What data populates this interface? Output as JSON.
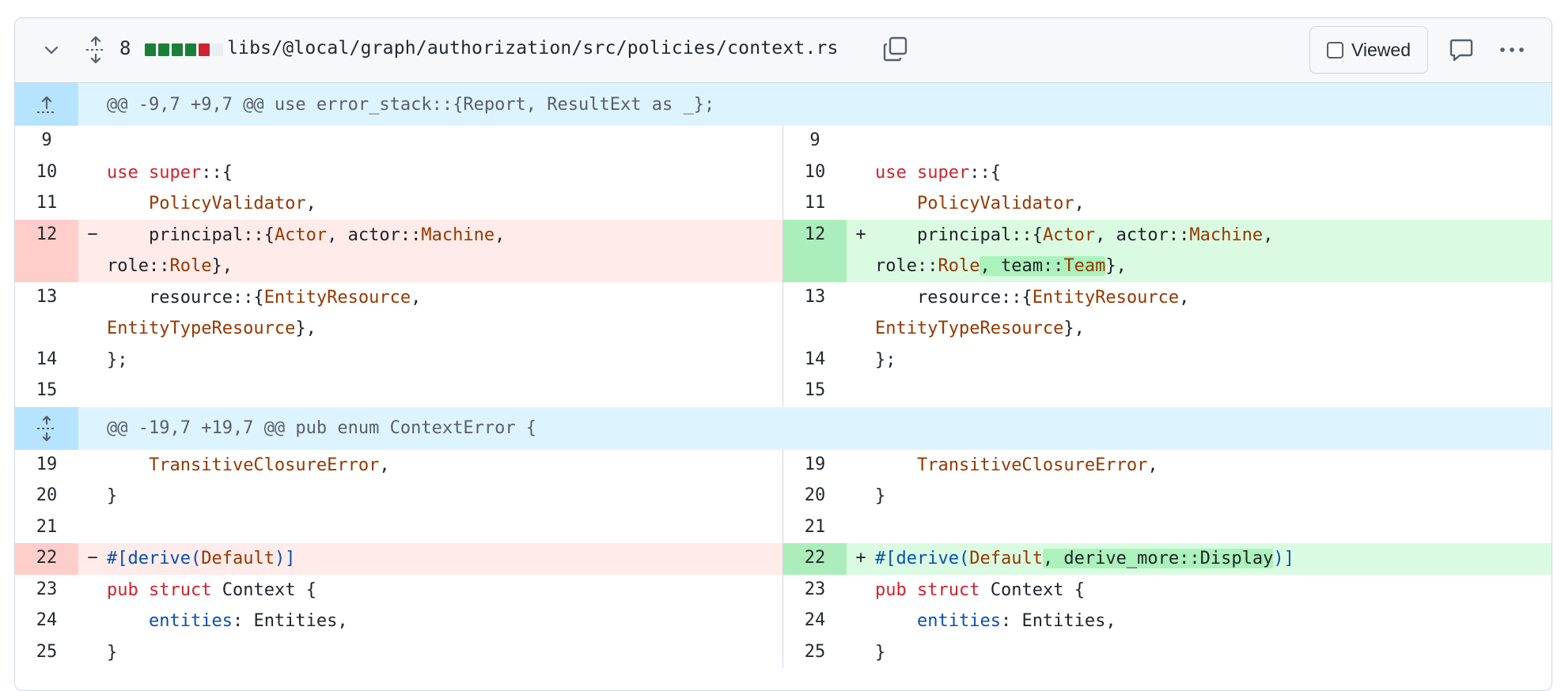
{
  "header": {
    "change_count": "8",
    "diffstat": [
      "#1a7f37",
      "#1a7f37",
      "#1a7f37",
      "#1a7f37",
      "#cf222e",
      "#eaeef2"
    ],
    "file_path": "libs/@local/graph/authorization/src/policies/context.rs",
    "viewed_label": "Viewed",
    "icons": [
      "chevron-down-icon",
      "unfold-icon",
      "copy-icon",
      "comment-icon",
      "kebab-horizontal-icon"
    ]
  },
  "hunks": [
    {
      "text": "@@ -9,7 +9,7 @@ use error_stack::{Report, ResultExt as _};"
    },
    {
      "text": "@@ -19,7 +19,7 @@ pub enum ContextError {"
    }
  ],
  "lines": {
    "l9": "9",
    "l10": "10",
    "l11": "11",
    "l12": "12",
    "l13": "13",
    "l14": "14",
    "l15": "15",
    "l19": "19",
    "l20": "20",
    "l21": "21",
    "l22": "22",
    "l23": "23",
    "l24": "24",
    "l25": "25"
  },
  "markers": {
    "del": "−",
    "add": "+"
  },
  "colors": {
    "deletion_bg": "#ffebe9",
    "deletion_num_bg": "#ffcecb",
    "addition_bg": "#dafbe1",
    "addition_num_bg": "#aceebb",
    "hunk_bg": "#ddf4ff",
    "hunk_expander_bg": "#b6e3ff",
    "keyword": "#cf222e",
    "type": "#953800",
    "attribute": "#0550ae"
  }
}
